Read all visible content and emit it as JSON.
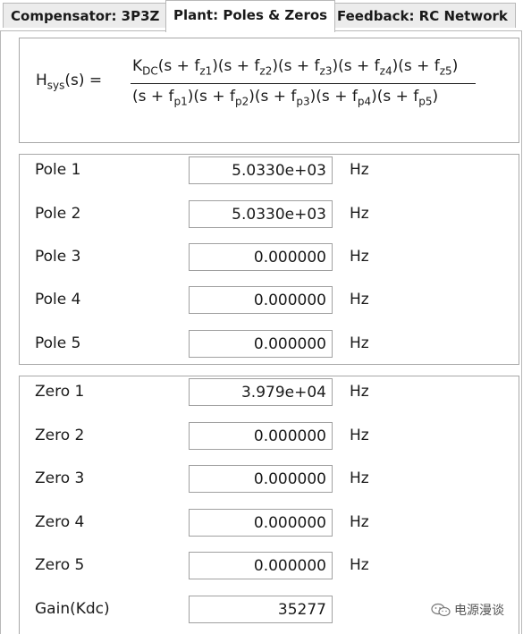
{
  "tabs": [
    {
      "label": "Compensator: 3P3Z"
    },
    {
      "label": "Plant: Poles & Zeros"
    },
    {
      "label": "Feedback: RC Network"
    }
  ],
  "formula": {
    "lhs_main": "H",
    "lhs_sub": "sys",
    "lhs_tail": "(s)  =",
    "numerator": {
      "k": "K",
      "k_sub": "DC",
      "s1": "(s + f",
      "sub1": "z1",
      "s2": ")(s + f",
      "sub2": "z2",
      "s3": ")(s + f",
      "sub3": "z3",
      "s4": ")(s + f",
      "sub4": "z4",
      "s5": ")(s + f",
      "sub5": "z5",
      "end": ")"
    },
    "denominator": {
      "s1": "(s + f",
      "sub1": "p1",
      "s2": ")(s + f",
      "sub2": "p2",
      "s3": ")(s + f",
      "sub3": "p3",
      "s4": ")(s + f",
      "sub4": "p4",
      "s5": ")(s + f",
      "sub5": "p5",
      "end": ")"
    }
  },
  "unit": "Hz",
  "poles": [
    {
      "label": "Pole 1",
      "value": "5.0330e+03"
    },
    {
      "label": "Pole 2",
      "value": "5.0330e+03"
    },
    {
      "label": "Pole 3",
      "value": "0.000000"
    },
    {
      "label": "Pole 4",
      "value": "0.000000"
    },
    {
      "label": "Pole 5",
      "value": "0.000000"
    }
  ],
  "zeros": [
    {
      "label": "Zero 1",
      "value": "3.979e+04"
    },
    {
      "label": "Zero 2",
      "value": "0.000000"
    },
    {
      "label": "Zero 3",
      "value": "0.000000"
    },
    {
      "label": "Zero 4",
      "value": "0.000000"
    },
    {
      "label": "Zero 5",
      "value": "0.000000"
    }
  ],
  "gain": {
    "label": "Gain(Kdc)",
    "value": "35277"
  },
  "watermark": {
    "text": "电源漫谈",
    "icon": "wechat-icon"
  }
}
